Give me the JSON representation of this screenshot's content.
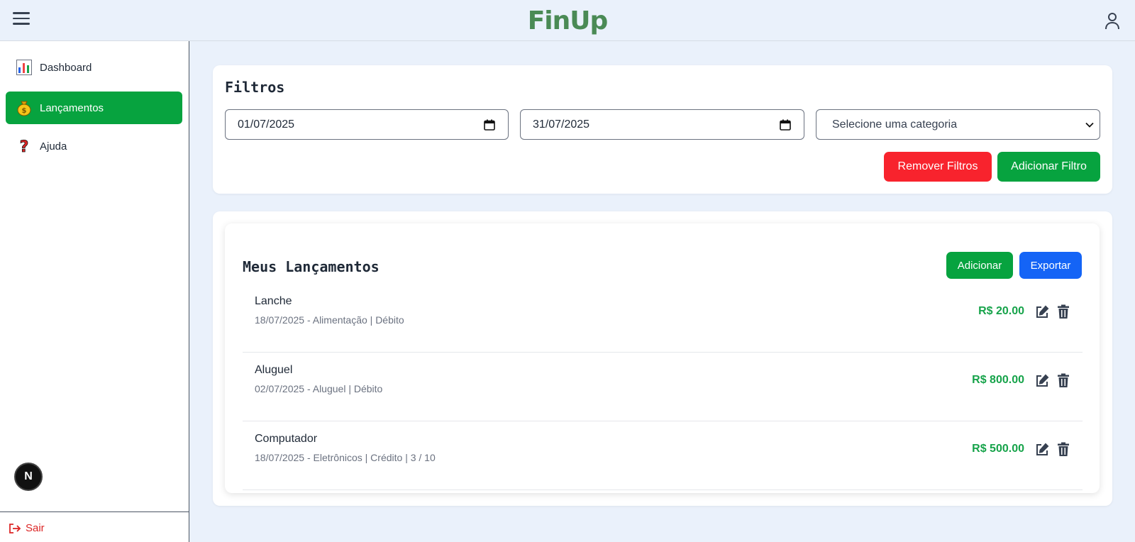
{
  "header": {
    "logo": "FinUp"
  },
  "sidebar": {
    "items": [
      {
        "label": "Dashboard",
        "icon": "bar-chart-icon",
        "active": false
      },
      {
        "label": "Lançamentos",
        "icon": "money-bag-icon",
        "active": true
      },
      {
        "label": "Ajuda",
        "icon": "question-mark-icon",
        "active": false
      }
    ],
    "logout_label": "Sair",
    "dev_badge": "N"
  },
  "filters": {
    "title": "Filtros",
    "start_date": "01/07/2025",
    "end_date": "31/07/2025",
    "category_placeholder": "Selecione uma categoria",
    "remove_label": "Remover Filtros",
    "add_label": "Adicionar Filtro"
  },
  "entries": {
    "title": "Meus Lançamentos",
    "add_label": "Adicionar",
    "export_label": "Exportar",
    "rows": [
      {
        "description": "Lanche",
        "meta": "18/07/2025 - Alimentação | Débito",
        "amount": "R$ 20.00"
      },
      {
        "description": "Aluguel",
        "meta": "02/07/2025 - Aluguel | Débito",
        "amount": "R$ 800.00"
      },
      {
        "description": "Computador",
        "meta": "18/07/2025 - Eletrônicos | Crédito | 3 / 10",
        "amount": "R$ 500.00"
      }
    ]
  },
  "colors": {
    "brand": "#4a8a55",
    "primary_green": "#07a33f",
    "danger_red": "#f8232d",
    "export_blue": "#1464f6",
    "amount_green": "#16a34a",
    "page_bg": "#eaf1fb"
  }
}
